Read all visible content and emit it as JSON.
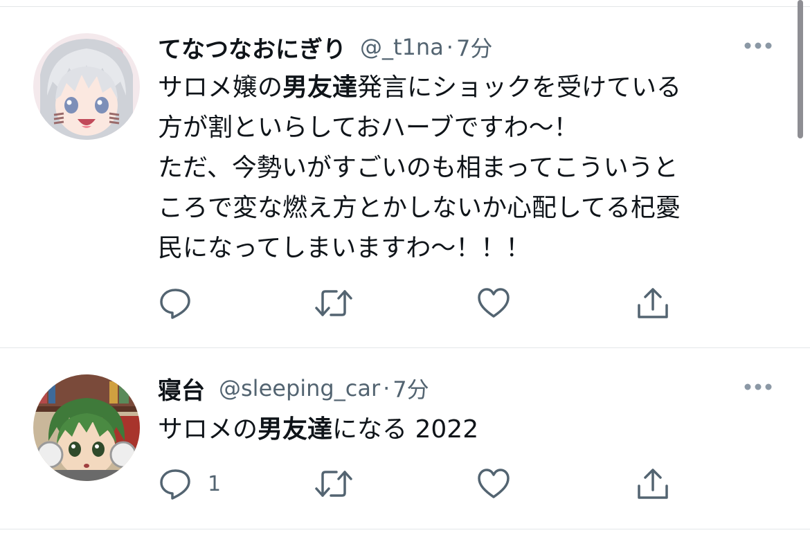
{
  "tweets": [
    {
      "display_name": "てなつなおにぎり",
      "handle": "@_t1na",
      "separator": "·",
      "time": "7分",
      "avatar_icon": "anime-girl-silver-hair-avatar",
      "text": {
        "l1a": "サロメ嬢の",
        "l1b": "男友達",
        "l1c": "発言にショックを受けている",
        "l2": "方が割といらしておハーブですわ〜！",
        "l3": "ただ、今勢いがすごいのも相まってこういうと",
        "l4": "ころで変な燃え方とかしないか心配してる杞憂",
        "l5": "民になってしまいますわ〜！！！"
      },
      "actions": {
        "reply_icon": "reply-icon",
        "retweet_icon": "retweet-icon",
        "like_icon": "heart-icon",
        "share_icon": "share-icon"
      }
    },
    {
      "display_name": "寝台",
      "handle": "@sleeping_car",
      "separator": "·",
      "time": "7分",
      "avatar_icon": "anime-boy-green-hair-headphones-avatar",
      "text": {
        "a": "サロメの",
        "b": "男友達",
        "c": "になる",
        "d": "2022"
      },
      "actions": {
        "reply_icon": "reply-icon",
        "reply_count": "1",
        "retweet_icon": "retweet-icon",
        "like_icon": "heart-icon",
        "share_icon": "share-icon"
      }
    }
  ],
  "colors": {
    "text": "#0f1419",
    "secondary": "#536471",
    "divider": "#e3e6e8",
    "icon": "#536471"
  }
}
